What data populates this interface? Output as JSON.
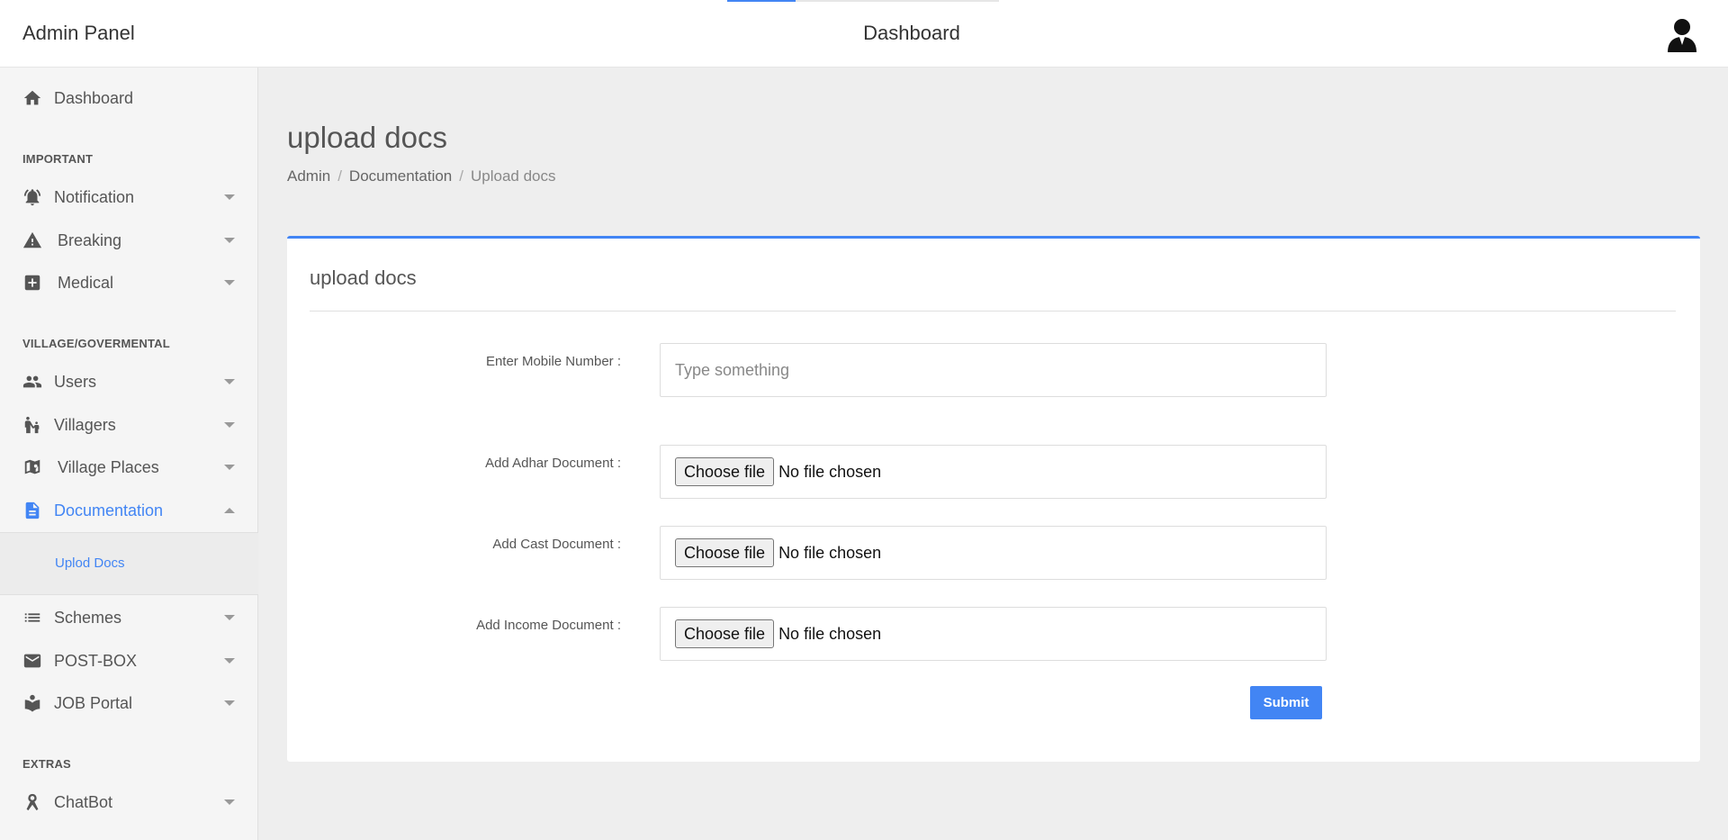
{
  "header": {
    "brand": "Admin Panel",
    "title": "Dashboard",
    "loading_progress": 0.25
  },
  "sidebar": {
    "dashboard": "Dashboard",
    "sections": {
      "important": "IMPORTANT",
      "village": "VILLAGE/GOVERMENTAL",
      "extras": "EXTRAS"
    },
    "items": {
      "notification": "Notification",
      "breaking": "Breaking",
      "medical": "Medical",
      "users": "Users",
      "villagers": "Villagers",
      "village_places": "Village Places",
      "documentation": "Documentation",
      "schemes": "Schemes",
      "post_box": "POST-BOX",
      "job_portal": "JOB Portal",
      "chatbot": "ChatBot"
    },
    "sub_items": {
      "upload_docs": "Uplod Docs"
    }
  },
  "main": {
    "page_title": "upload docs",
    "breadcrumb": [
      "Admin",
      "Documentation",
      "Upload docs"
    ],
    "breadcrumb_sep": "/",
    "card_title": "upload docs",
    "form": {
      "mobile_label": "Enter Mobile Number :",
      "mobile_placeholder": "Type something",
      "adhar_label": "Add Adhar Document :",
      "cast_label": "Add Cast Document :",
      "income_label": "Add Income Document :",
      "choose_file": "Choose file",
      "no_file": "No file chosen",
      "submit": "Submit"
    }
  },
  "colors": {
    "accent": "#4285f4",
    "background": "#eeeeee",
    "sidebar": "#f5f5f5"
  }
}
